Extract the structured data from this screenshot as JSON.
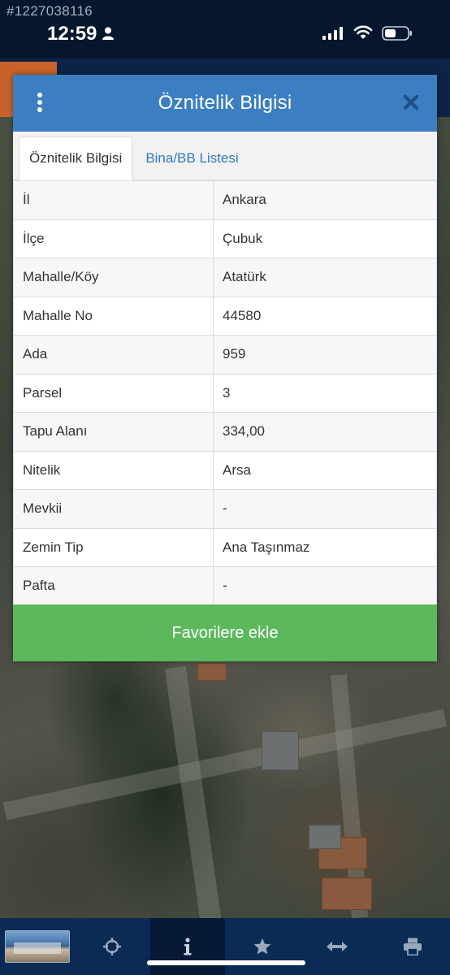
{
  "status_bar": {
    "watermark_id": "#1227038116",
    "time": "12:59"
  },
  "dialog": {
    "title": "Öznitelik Bilgisi",
    "tabs": [
      {
        "label": "Öznitelik Bilgisi",
        "active": true
      },
      {
        "label": "Bina/BB Listesi",
        "active": false
      }
    ],
    "rows": [
      {
        "key": "İl",
        "value": "Ankara"
      },
      {
        "key": "İlçe",
        "value": "Çubuk"
      },
      {
        "key": "Mahalle/Köy",
        "value": "Atatürk"
      },
      {
        "key": "Mahalle No",
        "value": "44580"
      },
      {
        "key": "Ada",
        "value": "959"
      },
      {
        "key": "Parsel",
        "value": "3"
      },
      {
        "key": "Tapu Alanı",
        "value": "334,00"
      },
      {
        "key": "Nitelik",
        "value": "Arsa"
      },
      {
        "key": "Mevkii",
        "value": "-"
      },
      {
        "key": "Zemin Tip",
        "value": "Ana Taşınmaz"
      },
      {
        "key": "Pafta",
        "value": "-"
      }
    ],
    "favorite_button": "Favorilere ekle"
  },
  "toolbar": {
    "items": [
      {
        "icon": "building-photo-thumbnail"
      },
      {
        "icon": "crosshair-icon"
      },
      {
        "icon": "info-icon",
        "active": true
      },
      {
        "icon": "star-icon"
      },
      {
        "icon": "measure-arrows-icon"
      },
      {
        "icon": "print-icon"
      }
    ]
  },
  "colors": {
    "header_blue": "#3b7ec2",
    "button_green": "#5cb85c",
    "link_blue": "#2f7bbd",
    "toolbar_navy": "#0b2a54"
  }
}
